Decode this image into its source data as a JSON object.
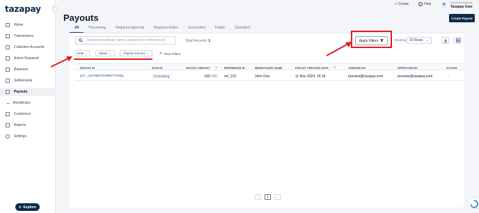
{
  "app": {
    "logo_text": "tazapay"
  },
  "sidebar": {
    "items": [
      {
        "label": "Home",
        "icon": "home-icon"
      },
      {
        "label": "Transactions",
        "icon": "transactions-icon"
      },
      {
        "label": "Collection Accounts",
        "icon": "collection-accounts-icon"
      },
      {
        "label": "Action Required",
        "icon": "action-required-icon"
      },
      {
        "label": "Balances",
        "icon": "balances-icon"
      },
      {
        "label": "Settlements",
        "icon": "settlements-icon"
      },
      {
        "label": "Payouts",
        "icon": "payouts-icon",
        "active": true
      },
      {
        "label": "Beneficiary",
        "icon": "dash-icon",
        "sub": true
      },
      {
        "label": "Customers",
        "icon": "customers-icon"
      },
      {
        "label": "Reports",
        "icon": "reports-icon"
      },
      {
        "label": "Settings",
        "icon": "settings-icon"
      }
    ],
    "explore_label": "Explore"
  },
  "topbar": {
    "create_label": "Create",
    "help_label": "Help",
    "avatar_initial": "P",
    "business_name": "The Demo Business",
    "user_name": "Tazapay User"
  },
  "page": {
    "title": "Payouts",
    "create_payout_label": "Create Payout"
  },
  "tabs": [
    "All",
    "Processing",
    "Requires Approval",
    "Requires Action",
    "Succeeded",
    "Failed",
    "Cancelled"
  ],
  "toolbar": {
    "search_placeholder": "Search beneficiary name, payout id or reference id",
    "total_records_label": "Total Records:",
    "total_records_value": "1",
    "apply_filters_label": "Apply Filters",
    "showing_label": "Showing",
    "rows_value": "20 Rows"
  },
  "filters": {
    "date_label": "Date",
    "status_label": "Status",
    "payout_amount_label": "Payout Amount",
    "clear_label": "Clear Filters"
  },
  "table": {
    "columns": [
      "PAYOUT ID",
      "STATUS",
      "PAYOUT AMOUNT",
      "REFERENCE ID",
      "BENEFICIARY NAME",
      "PAYOUT CREATED DATE",
      "CREATED BY",
      "APPROVED BY",
      "ACTION"
    ],
    "rows": [
      {
        "payout_id": "pot_cadl603tbo9657rb03g",
        "status": "Processing",
        "amount": "100",
        "currency": "USD",
        "reference_id": "ref_123",
        "beneficiary": "John Doe",
        "created_date": "11 Nov 2024, 15:18",
        "created_by": "preview@tazapay.com",
        "approved_by": "preview@tazapay.com",
        "action": "-"
      }
    ]
  },
  "pagination": {
    "prev": "‹",
    "current": "1",
    "next": "›"
  },
  "colors": {
    "brand": "#0f2b4a",
    "accent": "#1e3a8a",
    "annotation": "#e11d1d"
  }
}
